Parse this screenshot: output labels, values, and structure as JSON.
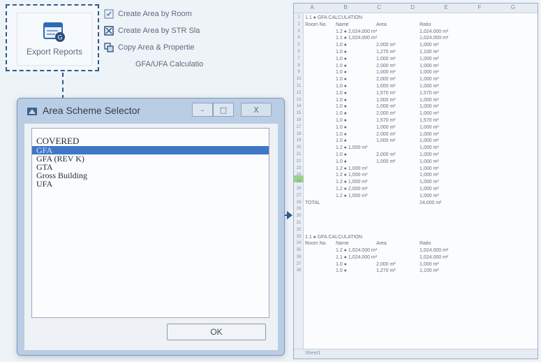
{
  "ribbon": {
    "export_button_label": "Export Reports",
    "items": [
      {
        "label": "Create Area by Room",
        "icon": "create-area-by-room-icon"
      },
      {
        "label": "Create Area by STR Sla",
        "icon": "create-area-by-slab-icon"
      },
      {
        "label": "Copy Area & Propertie",
        "icon": "copy-area-properties-icon"
      },
      {
        "label": "GFA/UFA Calculatio",
        "icon": ""
      }
    ]
  },
  "dialog": {
    "title": "Area Scheme Selector",
    "controls": {
      "minimize": "–",
      "maximize": "□",
      "close": "X"
    },
    "options": [
      "COVERED",
      "GFA",
      "GFA (REV K)",
      "GTA",
      "Gross Building",
      "UFA"
    ],
    "selected_index": 1,
    "ok_label": "OK"
  },
  "spreadsheet": {
    "columns": [
      "A",
      "B",
      "C",
      "D",
      "E",
      "F",
      "G"
    ],
    "footer_left": "Sheet1",
    "rows": [
      {
        "n": "1",
        "a": "1.1 ● GFA CALCULATION",
        "b": "",
        "c": "",
        "d": ""
      },
      {
        "n": "2",
        "a": "Room No.",
        "b": "Name",
        "c": "Area",
        "d": "Ratio"
      },
      {
        "n": "3",
        "a": "",
        "b": "1.2 ● 2,024.000 m²",
        "c": "",
        "d": "1,024.000 m²"
      },
      {
        "n": "4",
        "a": "",
        "b": "1.1 ● 1,024.000 m²",
        "c": "",
        "d": "1,024.000 m²"
      },
      {
        "n": "5",
        "a": "",
        "b": "1.0 ●",
        "c": "2,000 m²",
        "d": "1,000 m²"
      },
      {
        "n": "6",
        "a": "",
        "b": "1.0 ●",
        "c": "1,270 m²",
        "d": "1,100 m²"
      },
      {
        "n": "7",
        "a": "",
        "b": "1.0 ●",
        "c": "1,000 m²",
        "d": "1,000 m²"
      },
      {
        "n": "8",
        "a": "",
        "b": "1.0 ●",
        "c": "2,000 m²",
        "d": "1,000 m²"
      },
      {
        "n": "9",
        "a": "",
        "b": "1.0 ●",
        "c": "1,000 m²",
        "d": "1,000 m²"
      },
      {
        "n": "10",
        "a": "",
        "b": "1.0 ●",
        "c": "2,000 m²",
        "d": "1,000 m²"
      },
      {
        "n": "11",
        "a": "",
        "b": "1.0 ●",
        "c": "1,000 m²",
        "d": "1,000 m²"
      },
      {
        "n": "12",
        "a": "",
        "b": "1.0 ●",
        "c": "1,570 m²",
        "d": "1,570 m²"
      },
      {
        "n": "13",
        "a": "",
        "b": "1.0 ●",
        "c": "1,000 m²",
        "d": "1,000 m²"
      },
      {
        "n": "14",
        "a": "",
        "b": "1.0 ●",
        "c": "1,000 m²",
        "d": "1,000 m²"
      },
      {
        "n": "15",
        "a": "",
        "b": "1.0 ●",
        "c": "2,000 m²",
        "d": "1,000 m²"
      },
      {
        "n": "16",
        "a": "",
        "b": "1.0 ●",
        "c": "1,570 m²",
        "d": "1,570 m²"
      },
      {
        "n": "17",
        "a": "",
        "b": "1.0 ●",
        "c": "1,000 m²",
        "d": "1,000 m²"
      },
      {
        "n": "18",
        "a": "",
        "b": "1.0 ●",
        "c": "2,000 m²",
        "d": "1,000 m²"
      },
      {
        "n": "19",
        "a": "",
        "b": "1.0 ●",
        "c": "1,000 m²",
        "d": "1,000 m²"
      },
      {
        "n": "20",
        "a": "",
        "b": "1.2 ● 1,000 m²",
        "c": "",
        "d": "1,000 m²"
      },
      {
        "n": "21",
        "a": "",
        "b": "1.0 ●",
        "c": "2,000 m²",
        "d": "1,000 m²"
      },
      {
        "n": "22",
        "a": "",
        "b": "1.0 ●",
        "c": "1,000 m²",
        "d": "1,000 m²"
      },
      {
        "n": "23",
        "a": "",
        "b": "1.2 ● 1,000 m²",
        "c": "",
        "d": "1,000 m²"
      },
      {
        "n": "24",
        "a": "",
        "b": "1.2 ● 1,000 m²",
        "c": "",
        "d": "1,000 m²"
      },
      {
        "n": "25",
        "a": "",
        "b": "1.2 ● 1,000 m²",
        "c": "",
        "d": "1,000 m²"
      },
      {
        "n": "26",
        "a": "",
        "b": "1.2 ● 2,000 m²",
        "c": "",
        "d": "1,000 m²"
      },
      {
        "n": "27",
        "a": "",
        "b": "1.2 ● 1,000 m²",
        "c": "",
        "d": "1,000 m²"
      },
      {
        "n": "28",
        "a": "TOTAL",
        "b": "",
        "c": "",
        "d": "24,000 m²"
      },
      {
        "n": "29",
        "a": "",
        "b": "",
        "c": "",
        "d": ""
      },
      {
        "n": "30",
        "a": "",
        "b": "",
        "c": "",
        "d": ""
      },
      {
        "n": "31",
        "a": "",
        "b": "",
        "c": "",
        "d": ""
      },
      {
        "n": "32",
        "a": "",
        "b": "",
        "c": "",
        "d": ""
      },
      {
        "n": "33",
        "a": "1.1 ● GFA CALCULATION",
        "b": "",
        "c": "",
        "d": ""
      },
      {
        "n": "34",
        "a": "Room No.",
        "b": "Name",
        "c": "Area",
        "d": "Ratio"
      },
      {
        "n": "35",
        "a": "",
        "b": "1.2 ● 1,024.000 m²",
        "c": "",
        "d": "1,024.000 m²"
      },
      {
        "n": "36",
        "a": "",
        "b": "1.1 ● 1,024.000 m²",
        "c": "",
        "d": "1,024.000 m²"
      },
      {
        "n": "37",
        "a": "",
        "b": "1.0 ●",
        "c": "2,000 m²",
        "d": "1,000 m²"
      },
      {
        "n": "38",
        "a": "",
        "b": "1.0 ●",
        "c": "1,270 m²",
        "d": "1,100 m²"
      }
    ]
  }
}
